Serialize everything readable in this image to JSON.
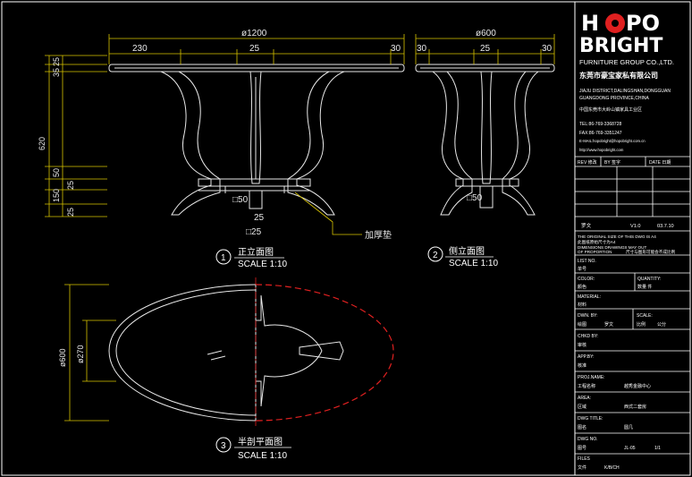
{
  "brand": {
    "logo_text_1": "H",
    "logo_text_2": "PO",
    "logo_text_3": "BRIGHT",
    "company_en": "FURNITURE GROUP CO.,LTD.",
    "company_cn": "东莞市豪宝家私有限公司",
    "address_en_1": "JIAJU DISTRICT,DALINGSHAN,DONGGUAN",
    "address_en_2": "GUANGDONG PROVINCE,CHINA",
    "address_cn": "中国东莞市大岭山镇家具工业区",
    "tel": "TEL:86-769-3368728",
    "fax": "FAX:86-769-3351247",
    "email": "E-MAIL:hopobright@hopobright.com.cn",
    "web": "http://www.hopobright.com"
  },
  "revision": {
    "col1": "REV 修改",
    "col2": "BY 签字",
    "col3": "DATE 日期",
    "drawn": "罗文",
    "version": "V1.0",
    "date": "03.7.10"
  },
  "notes": {
    "line1": "THE ORIGINAL SIZE OF THIS DWG IS A4",
    "line2": "此图纸原始尺寸为A4",
    "line3": "DIMENSIONS DRAWINGS MAY OUT",
    "line4": "OF PROPORTION",
    "line5": "尺寸与图形可能会不成比例"
  },
  "fields": {
    "list_no_en": "LIST NO.",
    "list_no_cn": "单号",
    "color_en": "COLOR:",
    "color_cn": "颜色",
    "quantity_en": "QUANTITY:",
    "quantity_val": "数量   件",
    "material_en": "MATERIAL:",
    "material_cn": "材料",
    "dwn_by_en": "DWN. BY:",
    "dwn_by_cn": "绘图",
    "dwn_by_val": "罗文",
    "scale_en": "SCALE:",
    "scale_cn": "比例",
    "scale_val": "公分",
    "chkd_en": "CHKD BY:",
    "chkd_cn": "审核",
    "appd_en": "APP.BY:",
    "appd_cn": "核准",
    "project_en": "PROJ.NAME:",
    "project_cn": "工程名称",
    "project_val": "越秀金融中心",
    "area_en": "AREA:",
    "area_cn": "区域",
    "area_val": "西式二套房",
    "dwg_title_en": "DWG TITLE:",
    "dwg_title_cn": "图名",
    "dwg_title_val": "圆几",
    "dwg_no_en": "DWG NO.",
    "dwg_no_cn": "图号",
    "dwg_no_val": "JL-05",
    "dwg_no_page": "1/1",
    "files_en": "FILES",
    "files_cn": "文件",
    "files_val": "K/B/CH"
  },
  "views": {
    "front_num": "1",
    "front_title": "正立面图",
    "front_scale": "SCALE 1:10",
    "side_num": "2",
    "side_title": "侧立面图",
    "side_scale": "SCALE 1:10",
    "plan_num": "3",
    "plan_title": "半剖平面图",
    "plan_scale": "SCALE 1:10"
  },
  "dimensions": {
    "front_width": "ø1200",
    "front_230": "230",
    "front_25": "25",
    "front_30": "30",
    "side_width": "ø600",
    "side_30a": "30",
    "side_25": "25",
    "side_30b": "30",
    "v_25a": "25",
    "v_35": "35",
    "v_620": "620",
    "v_50": "50",
    "v_25b": "25",
    "v_150": "150",
    "v_25c": "25",
    "sq50_front": "□50",
    "sq25_front": "□25",
    "sq50_side": "□50",
    "v25_front": "25",
    "callout": "加厚垫",
    "plan_600": "ø600",
    "plan_270": "ø270"
  }
}
